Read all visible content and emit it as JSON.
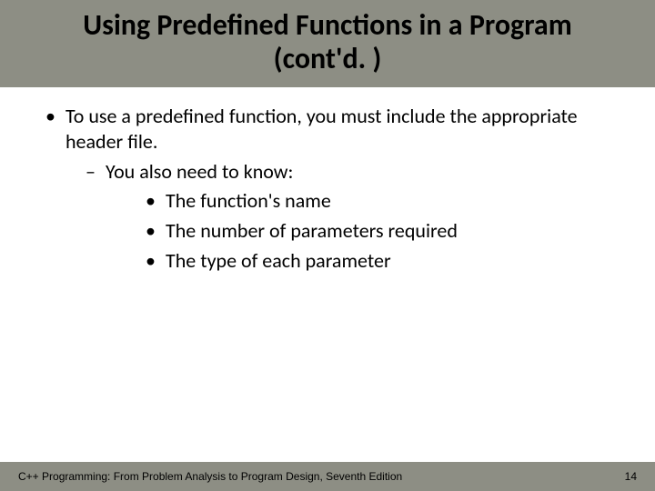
{
  "title": "Using Predefined Functions in a Program (cont'd. )",
  "body": {
    "item1": "To use a predefined function, you must include the appropriate header file.",
    "sub1": "You also need to know:",
    "subsub1": "The function's name",
    "subsub2": "The number of parameters required",
    "subsub3": "The type of each parameter"
  },
  "footer": {
    "left": "C++ Programming: From Problem Analysis to Program Design, Seventh Edition",
    "right": "14"
  }
}
